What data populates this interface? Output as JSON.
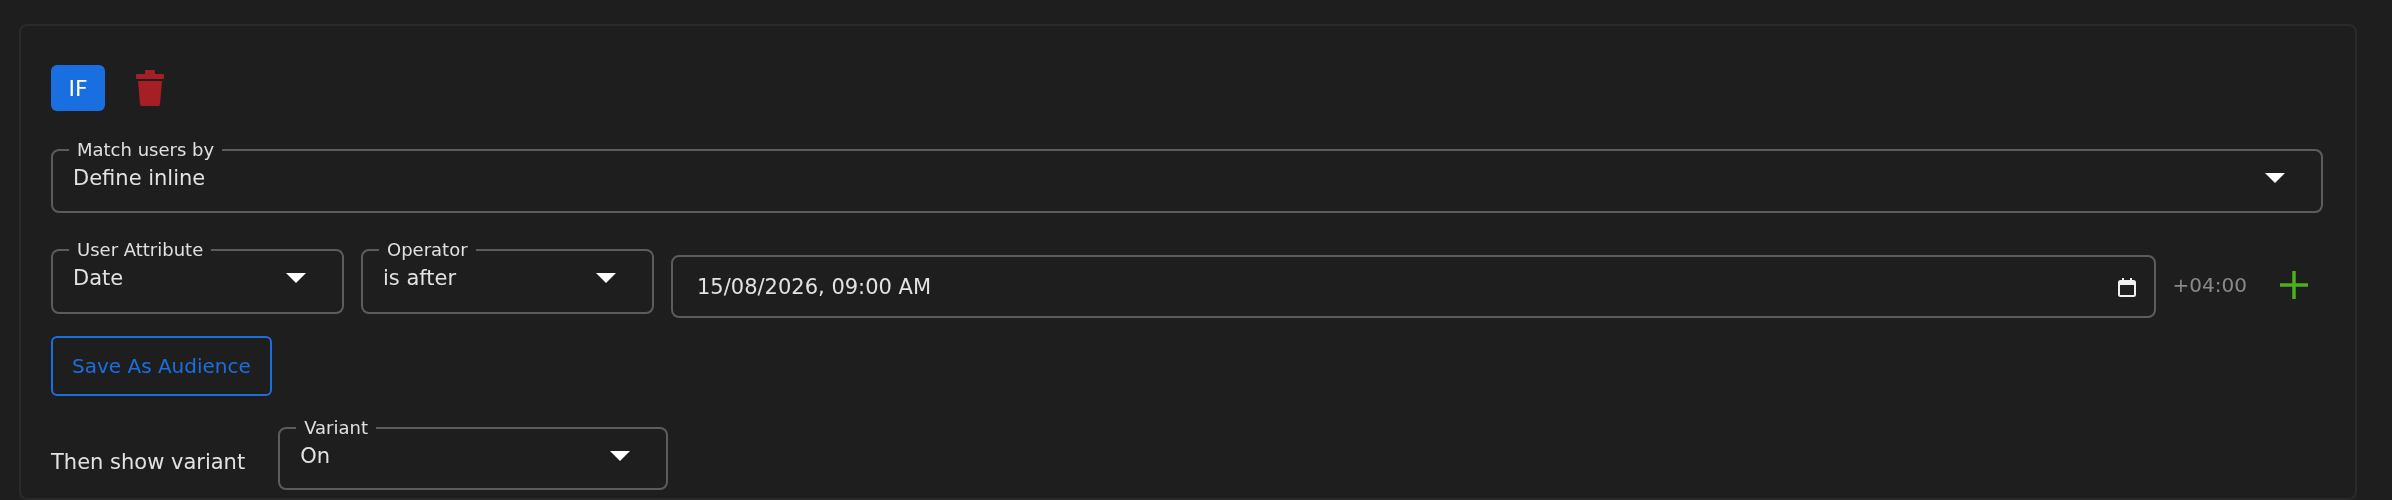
{
  "condition": {
    "badge": "IF"
  },
  "match_users_by": {
    "label": "Match users by",
    "value": "Define inline"
  },
  "rule": {
    "attribute": {
      "label": "User Attribute",
      "value": "Date"
    },
    "operator": {
      "label": "Operator",
      "value": "is after"
    },
    "date_value": "15/08/2026, 09:00 AM",
    "timezone": "+04:00"
  },
  "save_button": "Save As Audience",
  "variant": {
    "prompt": "Then show variant",
    "label": "Variant",
    "value": "On"
  }
}
